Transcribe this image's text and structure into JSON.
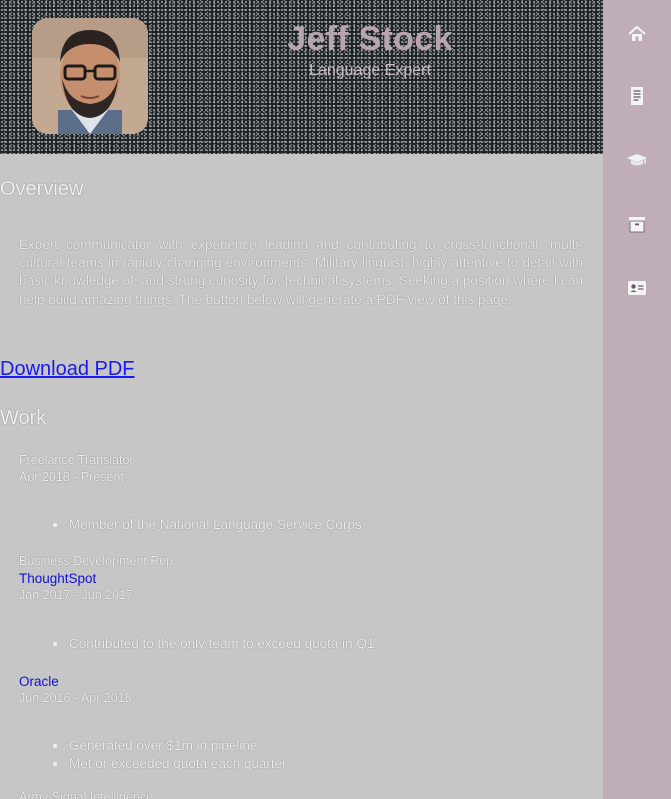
{
  "profile": {
    "name": "Jeff Stock",
    "tagline": "Language Expert"
  },
  "overview": {
    "title": "Overview",
    "text": "Expert communicator with experience leading and contributing to cross-functional, multi-cultural teams in rapidly changing environments. Military linguist, highly attentive to detail with basic knowledge of, and strong curiosity for, technical systems. Seeking a position where I can help build amazing things. The button below will generate a PDF view of this page."
  },
  "download_label": "Download PDF",
  "work": {
    "title": "Work",
    "jobs": [
      {
        "title": "Freelance Translator",
        "company": "",
        "dates": "Apr 2018 - Present",
        "bullets": [
          "Member of the National Language Service Corps"
        ]
      },
      {
        "title": "Business Development Rep",
        "company": "ThoughtSpot",
        "dates": "Jan 2017 - Jun 2017",
        "bullets": [
          "Contributed to the only team to exceed quota in Q1"
        ]
      },
      {
        "title": "",
        "company": "Oracle",
        "dates": "Jun 2016 - Apr 2018",
        "bullets": [
          "Generated over $1m in pipeline",
          "Met or exceeded quota each quarter"
        ]
      }
    ],
    "next_entry_partial": "Army Signal Intelligence"
  },
  "sidebar": {
    "items": [
      {
        "icon": "home-icon"
      },
      {
        "icon": "resume-document-icon"
      },
      {
        "icon": "graduation-cap-icon"
      },
      {
        "icon": "archive-box-icon"
      },
      {
        "icon": "contact-card-icon"
      }
    ]
  },
  "colors": {
    "header_bg": "#1e2426",
    "name": "#b7a4af",
    "sidebar_bg": "#bfadb8",
    "content_bg": "#c6c6c6",
    "link": "#1a1aee",
    "company": "#1212d8"
  }
}
